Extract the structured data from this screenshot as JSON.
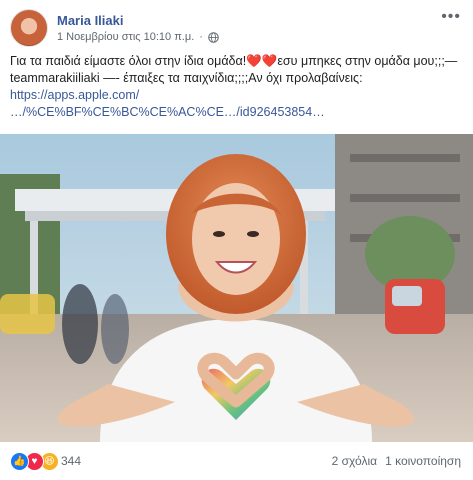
{
  "post": {
    "author": "Maria Iliaki",
    "date": "1 Νοεμβρίου στις 10:10 π.μ.",
    "separator": "·",
    "privacy_icon": "globe-icon",
    "more_icon": "more-options-icon",
    "text_part1": "Για τα παιδιά είμαστε όλοι στην ίδια ομάδα!",
    "text_hearts": "❤️❤️",
    "text_part2": "εσυ μπηκες στην ομάδα μου;;;—teammarakiiliaki —- έπαιξες τα παιχνίδια;;;;Αν όχι προλαβαίνεις:",
    "link_line1": "https://apps.apple.com/",
    "link_line2": "…/%CE%BF%CE%BC%CE%AC%CE…/id926453854…"
  },
  "footer": {
    "reaction_icons": [
      "like-icon",
      "love-icon",
      "haha-icon"
    ],
    "reaction_count": "344",
    "comments": "2 σχόλια",
    "shares": "1 κοινοποίηση"
  },
  "colors": {
    "link": "#385898",
    "meta": "#616770",
    "like": "#1877f2",
    "love": "#f0284a",
    "haha": "#f7b125"
  }
}
